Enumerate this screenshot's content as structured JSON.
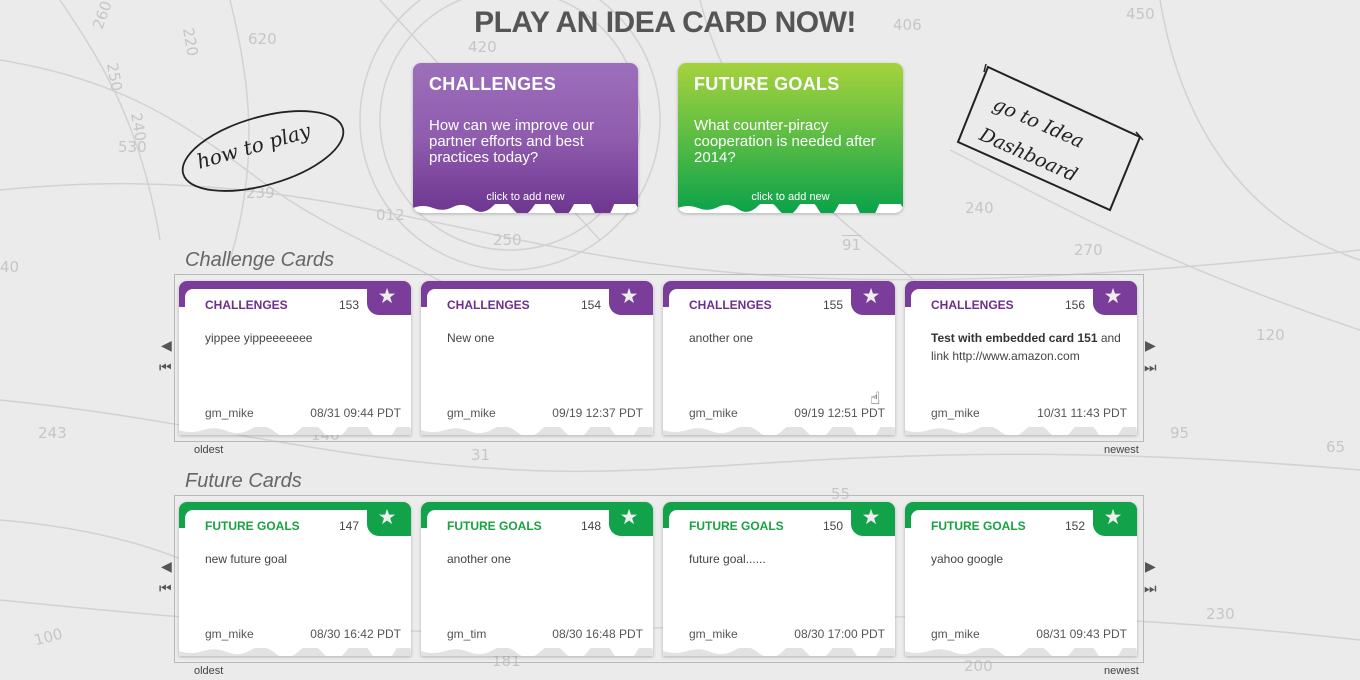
{
  "page": {
    "title": "PLAY AN IDEA CARD NOW!",
    "how_to_play": "how to play",
    "dashboard_line1": "go to Idea",
    "dashboard_line2": "Dashboard"
  },
  "background_numbers": [
    "260",
    "620",
    "420",
    "406",
    "450",
    "250",
    "220",
    "240",
    "530",
    "239",
    "012",
    "250",
    "240",
    "91",
    "270",
    "40",
    "120",
    "140",
    "243",
    "31",
    "95",
    "65",
    "55",
    "100",
    "181",
    "200",
    "230"
  ],
  "big_cards": [
    {
      "title": "CHALLENGES",
      "question": "How can we improve our partner efforts and best practices today?",
      "action": "click to add new",
      "color": "#8c57ac"
    },
    {
      "title": "FUTURE GOALS",
      "question": "What counter-piracy cooperation is needed after 2014?",
      "action": "click to add new",
      "color": "#1faa48"
    }
  ],
  "challenge_section": {
    "label": "Challenge Cards",
    "oldest": "oldest",
    "newest": "newest",
    "cards": [
      {
        "type": "CHALLENGES",
        "id": "153",
        "text": "yippee yippeeeeeee",
        "author": "gm_mike",
        "date": "08/31 09:44 PDT"
      },
      {
        "type": "CHALLENGES",
        "id": "154",
        "text": "New one",
        "author": "gm_mike",
        "date": "09/19 12:37 PDT"
      },
      {
        "type": "CHALLENGES",
        "id": "155",
        "text": "another one",
        "author": "gm_mike",
        "date": "09/19 12:51 PDT"
      },
      {
        "type": "CHALLENGES",
        "id": "156",
        "text_bold": "Test with embedded card 151",
        "text_rest": " and link http://www.amazon.com",
        "author": "gm_mike",
        "date": "10/31 11:43 PDT"
      }
    ]
  },
  "future_section": {
    "label": "Future Cards",
    "oldest": "oldest",
    "newest": "newest",
    "cards": [
      {
        "type": "FUTURE GOALS",
        "id": "147",
        "text": "new future goal",
        "author": "gm_mike",
        "date": "08/30 16:42 PDT"
      },
      {
        "type": "FUTURE GOALS",
        "id": "148",
        "text": "another one",
        "author": "gm_tim",
        "date": "08/30 16:48 PDT"
      },
      {
        "type": "FUTURE GOALS",
        "id": "150",
        "text": "future goal......",
        "author": "gm_mike",
        "date": "08/30 17:00 PDT"
      },
      {
        "type": "FUTURE GOALS",
        "id": "152",
        "text": "yahoo google",
        "author": "gm_mike",
        "date": "08/31 09:43 PDT"
      }
    ]
  },
  "icons": {
    "star": "star-icon",
    "prev": "arrow-left-icon",
    "first": "skip-first-icon",
    "next": "arrow-right-icon",
    "last": "skip-last-icon"
  },
  "colors": {
    "purple": "#7a3d99",
    "green": "#12a34a",
    "background": "#ebebeb"
  }
}
